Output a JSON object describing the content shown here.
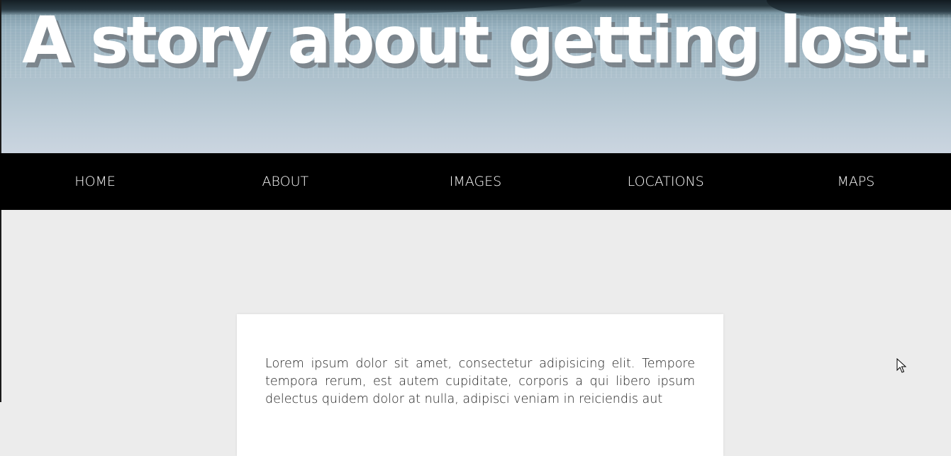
{
  "header": {
    "title": "A story about getting lost."
  },
  "nav": {
    "items": [
      {
        "label": "HOME"
      },
      {
        "label": "ABOUT"
      },
      {
        "label": "IMAGES"
      },
      {
        "label": "LOCATIONS"
      },
      {
        "label": "MAPS"
      }
    ]
  },
  "content": {
    "paragraph": "Lorem ipsum dolor sit amet, consectetur adipisicing elit. Tempore tempora rerum, est autem cupiditate, corporis a qui libero ipsum delectus quidem dolor at nulla, adipisci veniam in reiciendis aut"
  },
  "colors": {
    "nav_background": "#000000",
    "page_background": "#ececec",
    "card_background": "#ffffff",
    "title_color": "#ffffff"
  },
  "icons": {
    "cursor": "mouse-pointer-icon"
  }
}
